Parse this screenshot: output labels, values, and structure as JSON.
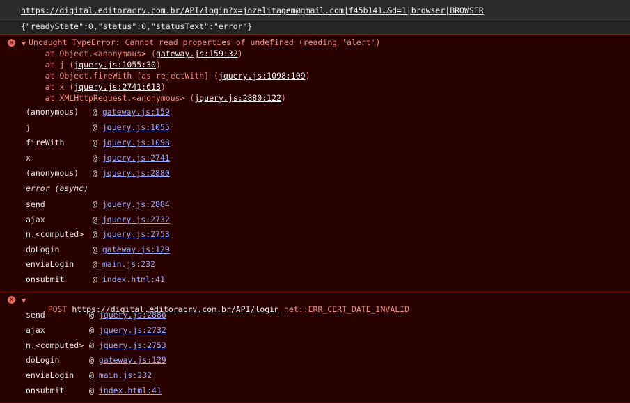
{
  "request_url": {
    "text": "https://digital.editoracrv.com.br/API/login?x=jozelitagem@gmail.com|f45b141…&d=1|browser|BROWSER"
  },
  "response_json": "{\"readyState\":0,\"status\":0,\"statusText\":\"error\"}",
  "error1": {
    "prefix": "Uncaught TypeError: Cannot read properties of undefined (reading 'alert')",
    "trace": [
      {
        "pre": "    at Object.<anonymous> (",
        "link": "gateway.js:159:32",
        "post": ")"
      },
      {
        "pre": "    at j (",
        "link": "jquery.js:1055:30",
        "post": ")"
      },
      {
        "pre": "    at Object.fireWith [as rejectWith] (",
        "link": "jquery.js:1098:109",
        "post": ")"
      },
      {
        "pre": "    at x (",
        "link": "jquery.js:2741:613",
        "post": ")"
      },
      {
        "pre": "    at XMLHttpRequest.<anonymous> (",
        "link": "jquery.js:2880:122",
        "post": ")"
      }
    ],
    "stack": [
      {
        "fn": "(anonymous)",
        "link": "gateway.js:159"
      },
      {
        "fn": "j",
        "link": "jquery.js:1055"
      },
      {
        "fn": "fireWith",
        "link": "jquery.js:1098"
      },
      {
        "fn": "x",
        "link": "jquery.js:2741"
      },
      {
        "fn": "(anonymous)",
        "link": "jquery.js:2880"
      }
    ],
    "async_label": "error (async)",
    "stack2": [
      {
        "fn": "send",
        "link": "jquery.js:2884"
      },
      {
        "fn": "ajax",
        "link": "jquery.js:2732"
      },
      {
        "fn": "n.<computed>",
        "link": "jquery.js:2753"
      },
      {
        "fn": "doLogin",
        "link": "gateway.js:129"
      },
      {
        "fn": "enviaLogin",
        "link": "main.js:232"
      },
      {
        "fn": "onsubmit",
        "link": "index.html:41"
      }
    ]
  },
  "error2": {
    "method": "POST",
    "url": "https://digital.editoracrv.com.br/API/login",
    "error_code": "net::ERR_CERT_DATE_INVALID",
    "stack": [
      {
        "fn": "send",
        "link": "jquery.js:2886"
      },
      {
        "fn": "ajax",
        "link": "jquery.js:2732"
      },
      {
        "fn": "n.<computed>",
        "link": "jquery.js:2753"
      },
      {
        "fn": "doLogin",
        "link": "gateway.js:129"
      },
      {
        "fn": "enviaLogin",
        "link": "main.js:232"
      },
      {
        "fn": "onsubmit",
        "link": "index.html:41"
      }
    ],
    "at_symbol": "@"
  },
  "icons": {
    "error": "error-circle-icon",
    "expand": "expanded-triangle-icon"
  },
  "colors": {
    "error_bg": "#290000",
    "error_text": "#f28b82",
    "link": "#9aa7ff"
  }
}
